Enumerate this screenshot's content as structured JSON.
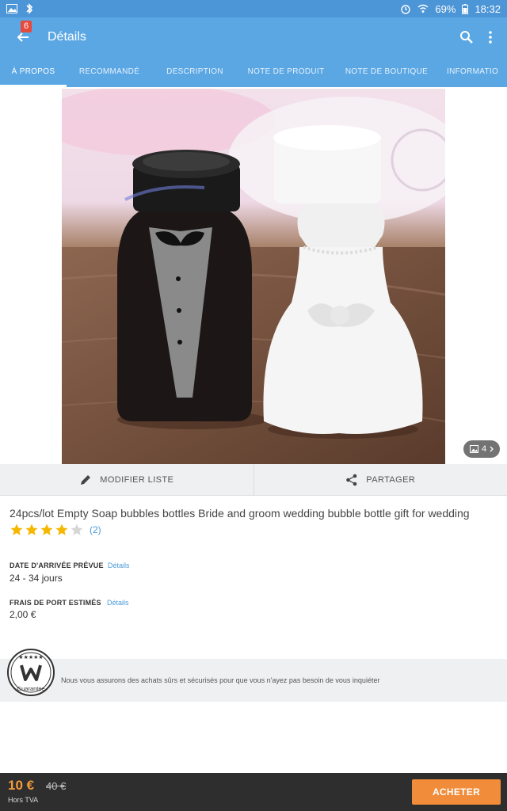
{
  "status": {
    "battery": "69%",
    "time": "18:32"
  },
  "appbar": {
    "badge": "6",
    "title": "Détails"
  },
  "tabs": [
    "À PROPOS",
    "RECOMMANDÉ",
    "DESCRIPTION",
    "NOTE DE PRODUIT",
    "NOTE DE BOUTIQUE",
    "INFORMATIO"
  ],
  "image": {
    "count": "4"
  },
  "actions": {
    "modify": "MODIFIER LISTE",
    "share": "PARTAGER"
  },
  "product": {
    "title": "24pcs/lot Empty Soap bubbles bottles Bride and groom wedding bubble bottle gift for wedding",
    "rating": 4,
    "review_count": "(2)"
  },
  "delivery": {
    "label": "DATE D'ARRIVÉE PRÉVUE",
    "link": "Détails",
    "value": "24 - 34 jours"
  },
  "shipping": {
    "label": "FRAIS DE PORT ESTIMÉS",
    "link": "Détails",
    "value": "2,00 €"
  },
  "guarantee": {
    "badge_text": "Guarantee",
    "text": "Nous vous assurons des achats sûrs et sécurisés pour que vous n'ayez pas besoin de vous inquiéter"
  },
  "purchase": {
    "price": "10 €",
    "old_price": "40 €",
    "tax_note": "Hors TVA",
    "buy_label": "ACHETER"
  },
  "colors": {
    "primary": "#5aa7e4",
    "accent": "#f08c3a",
    "link": "#4e9ad8",
    "star": "#f5b800"
  }
}
